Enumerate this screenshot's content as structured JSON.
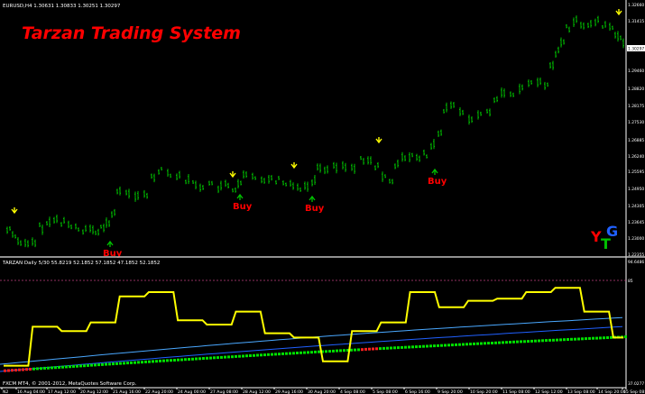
{
  "main_chart": {
    "header": "EURUSD,H4  1.30631 1.30833 1.30251 1.30297",
    "watermark_title": "Tarzan Trading System",
    "price_levels": [
      "1.32660",
      "1.31415",
      "1.30297",
      "1.29460",
      "1.28820",
      "1.28175",
      "1.27530",
      "1.26885",
      "1.26240",
      "1.25595",
      "1.24950",
      "1.24305",
      "1.23645",
      "1.23000",
      "1.22355"
    ],
    "current_price": "1.30297",
    "buy_label": "Buy",
    "buy_signals": [
      {
        "label": "Buy",
        "bar": 18
      },
      {
        "label": "Buy",
        "bar": 43
      },
      {
        "label": "Buy",
        "bar": 56
      },
      {
        "label": "Buy",
        "bar": 78
      }
    ],
    "sell_signals": [
      {
        "bar": 2
      },
      {
        "bar": 42
      },
      {
        "bar": 53
      },
      {
        "bar": 68
      },
      {
        "bar": 112
      }
    ],
    "logo": {
      "y": "Y",
      "t": "T",
      "g": "G"
    },
    "colors": {
      "candle": "#00c000",
      "buy": "#ff0000",
      "sell": "#ffff00",
      "title": "#ff0000"
    }
  },
  "indicator": {
    "header": "TARZAN Daily 5/30  55.8219 52.1852 57.1852 47.1852 52.1852",
    "levels": [
      "94.6486",
      "85",
      "37.0277"
    ],
    "footer": "FXCM MT4, © 2001-2012, MetaQuotes Software Corp.",
    "main_line_values": [
      12,
      12,
      48,
      48,
      44,
      44,
      52,
      52,
      76,
      76,
      80,
      80,
      54,
      54,
      50,
      50,
      62,
      62,
      42,
      42,
      38,
      38,
      16,
      16,
      44,
      44,
      52,
      52,
      80,
      80,
      66,
      66,
      72,
      72,
      74,
      74,
      80,
      80,
      84,
      84,
      62,
      62,
      38
    ],
    "colors": {
      "main": "#ffff00",
      "fast": "#00e000",
      "slow_a": "#4aa8ff",
      "slow_b": "#2060ff",
      "level": "#c04080"
    }
  },
  "time_axis": [
    "N2",
    "16 Aug 04:00",
    "17 Aug 12:00",
    "20 Aug 12:00",
    "21 Aug 16:00",
    "22 Aug 20:00",
    "24 Aug 00:00",
    "27 Aug 08:00",
    "28 Aug 12:00",
    "29 Aug 16:00",
    "30 Aug 20:00",
    "4 Sep 08:00",
    "5 Sep 08:00",
    "6 Sep 16:00",
    "9 Sep 20:00",
    "10 Sep 20:00",
    "11 Sep 08:00",
    "12 Sep 12:00",
    "13 Sep 08:00",
    "14 Sep 20:00",
    "15 Sep 08:00"
  ]
}
